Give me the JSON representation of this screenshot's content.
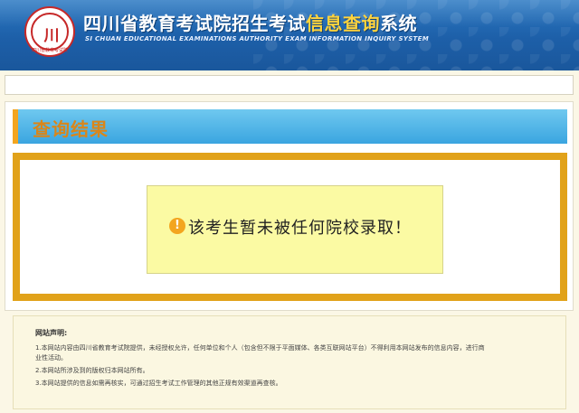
{
  "header": {
    "logo_text": "川",
    "logo_ring_text": "四川省教育考试院",
    "title_part1": "四川省教育考试院招生考试",
    "title_highlight": "信息查询",
    "title_part2": "系统",
    "subtitle": "SI CHUAN EDUCATIONAL EXAMINATIONS AUTHORITY EXAM INFORMATION INQUIRY SYSTEM"
  },
  "result": {
    "title": "查询结果",
    "alert_icon": "!",
    "message": "该考生暂未被任何院校录取！"
  },
  "notice": {
    "title": "网站声明:",
    "lines": [
      "1.本网站内容由四川省教育考试院提供，未经授权允许，任何单位和个人（包含但不限于平面媒体、各类互联网站平台）不得利用本网站发布的信息内容，进行商",
      "业性活动。",
      "2.本网站所涉及到的版权归本网站所有。",
      "3.本网站提供的信息如需再核实，可通过招生考试工作管理的其他正规有效渠道再查核。"
    ]
  },
  "colors": {
    "header_blue": "#1d5fa8",
    "accent_orange": "#e1a21a",
    "title_bar_blue": "#3aa5e0",
    "message_bg": "#fbfaa3"
  }
}
